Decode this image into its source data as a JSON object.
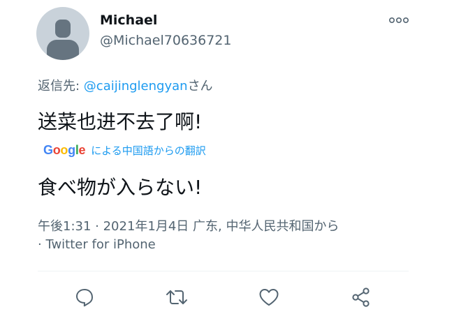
{
  "user": {
    "display_name": "Michael",
    "handle": "@Michael70636721"
  },
  "reply": {
    "prefix": "返信先: ",
    "mention": "@caijinglengyan",
    "suffix": "さん"
  },
  "tweet": {
    "text": "送菜也进不去了啊!"
  },
  "translation": {
    "provider_letters": [
      "G",
      "o",
      "o",
      "g",
      "l",
      "e"
    ],
    "provider_colors": [
      "#4285F4",
      "#EA4335",
      "#FBBC05",
      "#4285F4",
      "#34A853",
      "#EA4335"
    ],
    "label": "による中国語からの翻訳",
    "text": "食べ物が入らない!"
  },
  "meta": {
    "line1": "午後1:31 · 2021年1月4日 广东, 中华人民共和国から",
    "line2": "· Twitter for iPhone"
  },
  "actions": {
    "icons": [
      "reply-icon",
      "retweet-icon",
      "like-icon",
      "share-icon"
    ],
    "icon_color": "#536471"
  },
  "colors": {
    "accent": "#1d9bf0",
    "secondary_text": "#536471",
    "primary_text": "#0f1419"
  }
}
